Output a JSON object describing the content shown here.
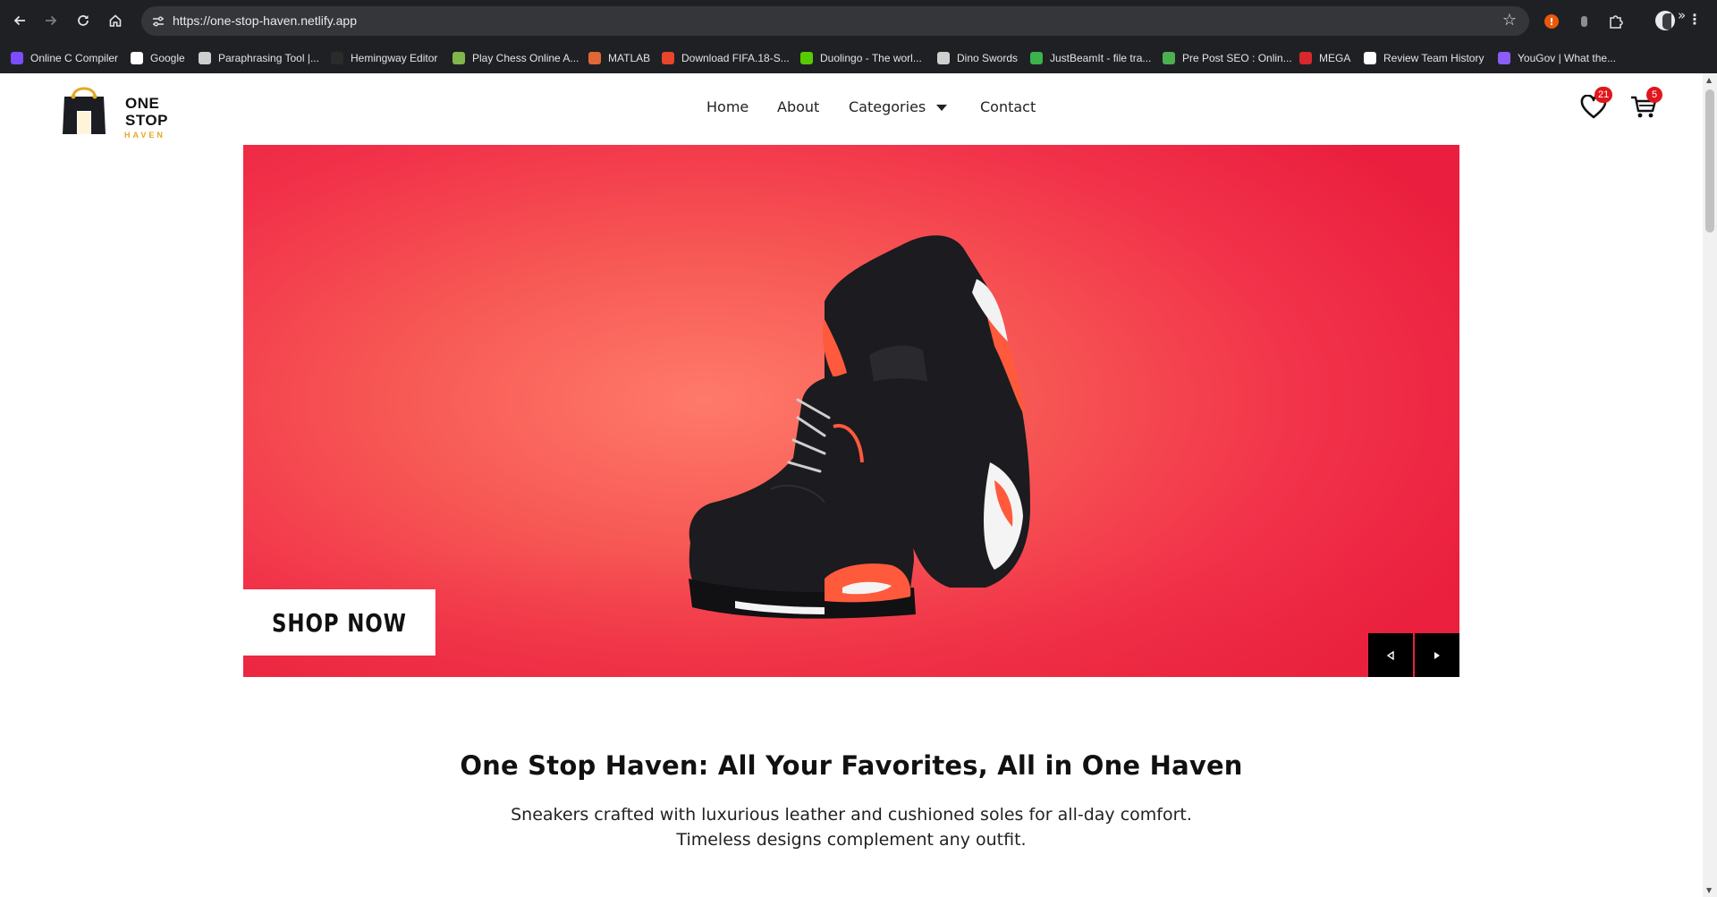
{
  "browser": {
    "url": "https://one-stop-haven.netlify.app",
    "bookmarks": [
      {
        "label": "Online C Compiler",
        "icon": "compiler-icon",
        "color": "#7b4dff"
      },
      {
        "label": "Google",
        "icon": "google-icon",
        "color": "#ffffff"
      },
      {
        "label": "Paraphrasing Tool |...",
        "icon": "quill-icon",
        "color": "#cfcfcf"
      },
      {
        "label": "Hemingway Editor",
        "icon": "hemingway-icon",
        "color": "#2b2b2b"
      },
      {
        "label": "Play Chess Online A...",
        "icon": "chess-pawn-icon",
        "color": "#81b64c"
      },
      {
        "label": "MATLAB",
        "icon": "matlab-icon",
        "color": "#e16737"
      },
      {
        "label": "Download FIFA.18-S...",
        "icon": "x-icon",
        "color": "#e8452c"
      },
      {
        "label": "Duolingo - The worl...",
        "icon": "duolingo-icon",
        "color": "#58cc02"
      },
      {
        "label": "Dino Swords",
        "icon": "sword-icon",
        "color": "#cfcfcf"
      },
      {
        "label": "JustBeamIt - file tra...",
        "icon": "beam-icon",
        "color": "#3bb34a"
      },
      {
        "label": "Pre Post SEO : Onlin...",
        "icon": "seo-icon",
        "color": "#4caf50"
      },
      {
        "label": "MEGA",
        "icon": "mega-icon",
        "color": "#d9272e"
      },
      {
        "label": "Review Team History",
        "icon": "review-icon",
        "color": "#ffffff"
      },
      {
        "label": "YouGov | What the...",
        "icon": "yougov-icon",
        "color": "#8b5cf6"
      }
    ]
  },
  "site": {
    "logo_line1": "ONE",
    "logo_line2": "STOP",
    "logo_sub": "HAVEN",
    "nav": {
      "home": "Home",
      "about": "About",
      "categories": "Categories",
      "contact": "Contact"
    },
    "wishlist_count": "21",
    "cart_count": "5",
    "accent_color": "#e0161c"
  },
  "hero": {
    "cta": "SHOP NOW",
    "prev_icon": "triangle-left-icon",
    "next_icon": "triangle-right-icon"
  },
  "intro": {
    "title": "One Stop Haven: All Your Favorites, All in One Haven",
    "line1": "Sneakers crafted with luxurious leather and cushioned soles for all-day comfort.",
    "line2": "Timeless designs complement any outfit."
  }
}
